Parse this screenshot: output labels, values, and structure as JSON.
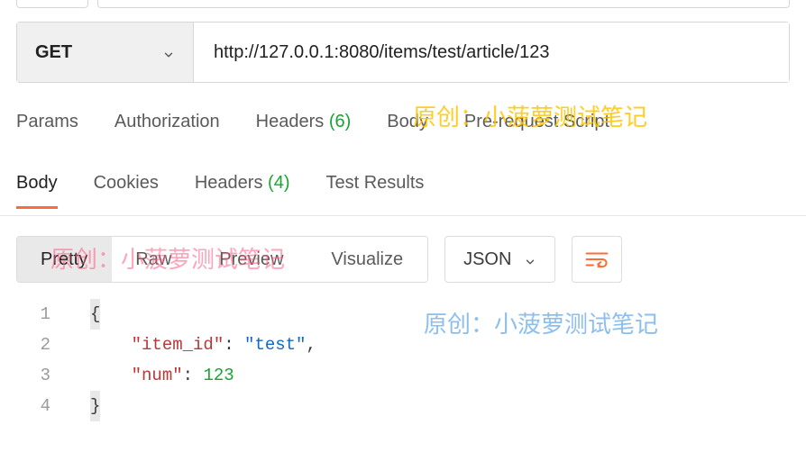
{
  "request": {
    "method": "GET",
    "url": "http://127.0.0.1:8080/items/test/article/123"
  },
  "req_tabs": {
    "params": "Params",
    "auth": "Authorization",
    "headers_label": "Headers",
    "headers_count": "(6)",
    "body": "Body",
    "prerequest": "Pre-request Script"
  },
  "resp_tabs": {
    "body": "Body",
    "cookies": "Cookies",
    "headers_label": "Headers",
    "headers_count": "(4)",
    "tests": "Test Results"
  },
  "view": {
    "pretty": "Pretty",
    "raw": "Raw",
    "preview": "Preview",
    "visualize": "Visualize",
    "format": "JSON"
  },
  "code": {
    "lines": {
      "l1": "1",
      "l2": "2",
      "l3": "3",
      "l4": "4"
    },
    "brace_open": "{",
    "brace_close": "}",
    "k_item": "\"item_id\"",
    "v_item": "\"test\"",
    "k_num": "\"num\"",
    "v_num": "123",
    "colon": ": ",
    "comma": ","
  },
  "watermark": {
    "text": "原创：小菠萝测试笔记"
  }
}
